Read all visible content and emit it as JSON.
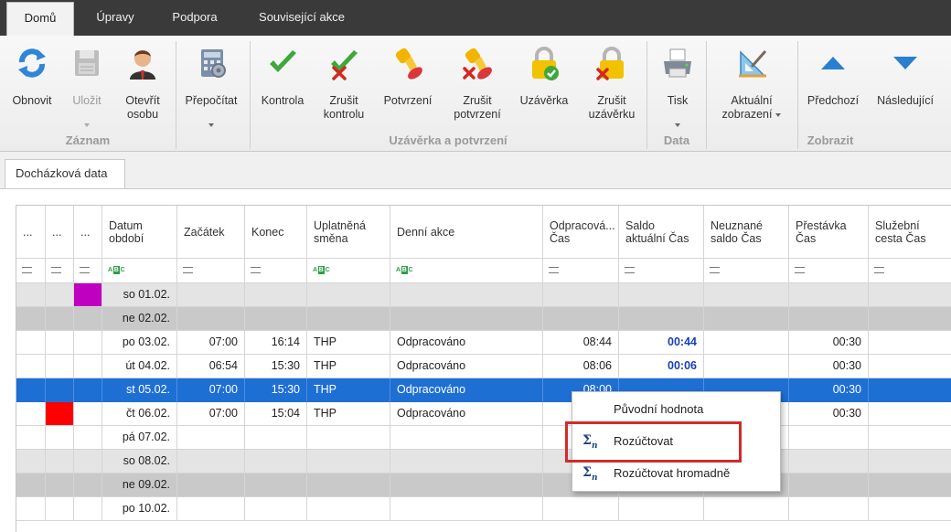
{
  "tabs": [
    "Domů",
    "Úpravy",
    "Podpora",
    "Související akce"
  ],
  "ribbon": {
    "buttons": {
      "refresh": "Obnovit",
      "save": "Uložit",
      "open_person": "Otevřít\nosobu",
      "recalc": "Přepočítat",
      "check": "Kontrola",
      "cancel_check": "Zrušit\nkontrolu",
      "confirm": "Potvrzení",
      "cancel_confirm": "Zrušit\npotvrzení",
      "lock": "Uzávěrka",
      "cancel_lock": "Zrušit\nuzávěrku",
      "print": "Tisk",
      "current_view": "Aktuální\nzobrazení",
      "previous": "Předchozí",
      "next": "Následující"
    },
    "groups": {
      "record": "Záznam",
      "lock_confirm": "Uzávěrka a potvrzení",
      "data": "Data",
      "view": "Zobrazit"
    }
  },
  "doc_tab": "Docházková data",
  "grid": {
    "headers": [
      "...",
      "...",
      "...",
      "Datum\nobdobí",
      "Začátek",
      "Konec",
      "Uplatněná\nsměna",
      "Denní akce",
      "Odpracová...\nČas",
      "Saldo\naktuální Čas",
      "Neuznané\nsaldo Čas",
      "Přestávka\nČas",
      "Služební\ncesta Čas"
    ],
    "rows": [
      {
        "date": "so 01.02.",
        "start": "",
        "end": "",
        "shift": "",
        "action": "",
        "worked": "",
        "saldo": "",
        "unacc": "",
        "break": "",
        "trip": ""
      },
      {
        "date": "ne 02.02.",
        "start": "",
        "end": "",
        "shift": "",
        "action": "",
        "worked": "",
        "saldo": "",
        "unacc": "",
        "break": "",
        "trip": ""
      },
      {
        "date": "po 03.02.",
        "start": "07:00",
        "end": "16:14",
        "shift": "THP",
        "action": "Odpracováno",
        "worked": "08:44",
        "saldo": "00:44",
        "unacc": "",
        "break": "00:30",
        "trip": ""
      },
      {
        "date": "út 04.02.",
        "start": "06:54",
        "end": "15:30",
        "shift": "THP",
        "action": "Odpracováno",
        "worked": "08:06",
        "saldo": "00:06",
        "unacc": "",
        "break": "00:30",
        "trip": ""
      },
      {
        "date": "st 05.02.",
        "start": "07:00",
        "end": "15:30",
        "shift": "THP",
        "action": "Odpracováno",
        "worked": "08:00",
        "saldo": "",
        "unacc": "",
        "break": "00:30",
        "trip": ""
      },
      {
        "date": "čt 06.02.",
        "start": "07:00",
        "end": "15:04",
        "shift": "THP",
        "action": "Odpracováno",
        "worked": "",
        "saldo": "",
        "unacc": "",
        "break": "00:30",
        "trip": ""
      },
      {
        "date": "pá 07.02.",
        "start": "",
        "end": "",
        "shift": "",
        "action": "",
        "worked": "",
        "saldo": "",
        "unacc": "",
        "break": "",
        "trip": ""
      },
      {
        "date": "so 08.02.",
        "start": "",
        "end": "",
        "shift": "",
        "action": "",
        "worked": "",
        "saldo": "",
        "unacc": "",
        "break": "",
        "trip": ""
      },
      {
        "date": "ne 09.02.",
        "start": "",
        "end": "",
        "shift": "",
        "action": "",
        "worked": "",
        "saldo": "",
        "unacc": "",
        "break": "",
        "trip": ""
      },
      {
        "date": "po 10.02.",
        "start": "",
        "end": "",
        "shift": "",
        "action": "",
        "worked": "",
        "saldo": "",
        "unacc": "",
        "break": "",
        "trip": ""
      }
    ]
  },
  "context_menu": [
    "Původní hodnota",
    "Rozúčtovat",
    "Rozúčtovat hromadně"
  ],
  "colors": {
    "selection": "#1e6fd4",
    "marker_magenta": "#c000c0",
    "marker_red": "#ff0000",
    "highlight": "#d12b2b",
    "saldo_text": "#1a3fb5"
  }
}
